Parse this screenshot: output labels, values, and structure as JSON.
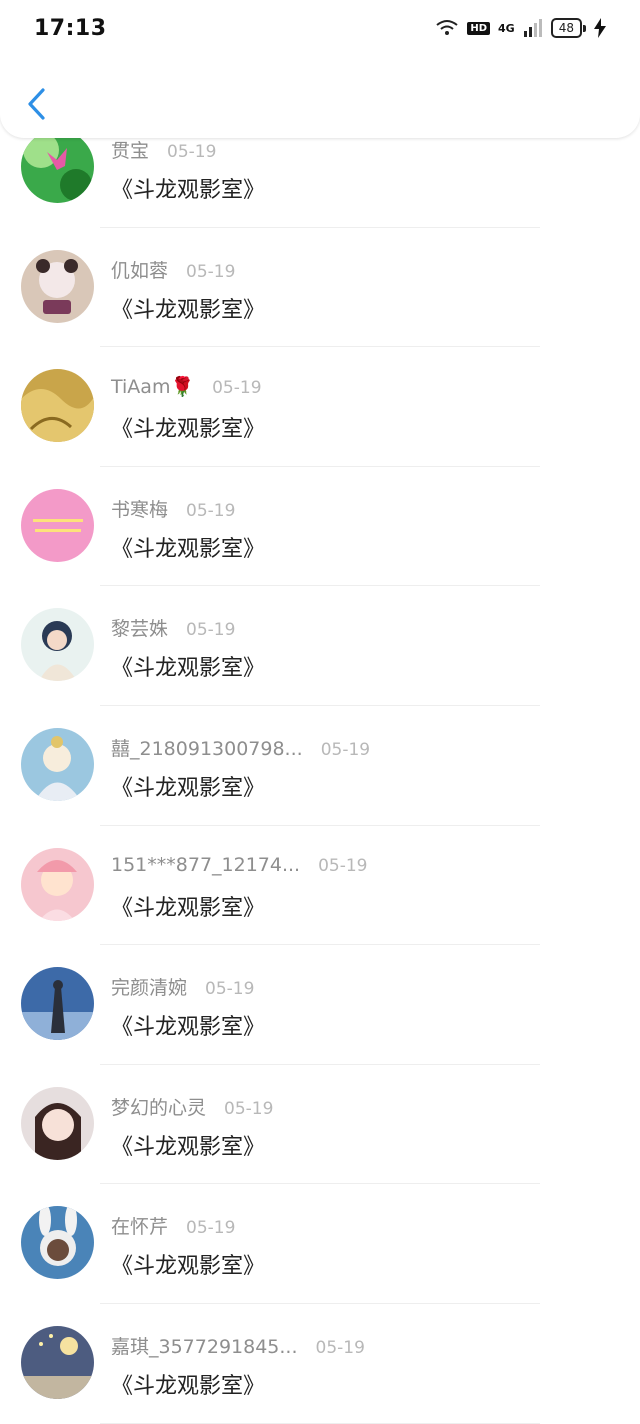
{
  "status_bar": {
    "time": "17:13",
    "hd": "HD",
    "network": "4G",
    "battery": "48"
  },
  "header": {
    "back_icon": "chevron-left-icon",
    "accent_color": "#2d8fe6"
  },
  "comments": [
    {
      "name": "贯宝",
      "date": "05-19",
      "text": "《斗龙观影室》"
    },
    {
      "name": "仉如蓉",
      "date": "05-19",
      "text": "《斗龙观影室》"
    },
    {
      "name": "TiAam🌹",
      "date": "05-19",
      "text": "《斗龙观影室》"
    },
    {
      "name": "书寒梅",
      "date": "05-19",
      "text": "《斗龙观影室》"
    },
    {
      "name": "黎芸姝",
      "date": "05-19",
      "text": "《斗龙观影室》"
    },
    {
      "name": "囍_218091300798...",
      "date": "05-19",
      "text": "《斗龙观影室》"
    },
    {
      "name": "151***877_12174...",
      "date": "05-19",
      "text": "《斗龙观影室》"
    },
    {
      "name": "完颜清婉",
      "date": "05-19",
      "text": "《斗龙观影室》"
    },
    {
      "name": "梦幻的心灵",
      "date": "05-19",
      "text": "《斗龙观影室》"
    },
    {
      "name": "在怀芹",
      "date": "05-19",
      "text": "《斗龙观影室》"
    },
    {
      "name": "嘉琪_3577291845...",
      "date": "05-19",
      "text": "《斗龙观影室》"
    }
  ]
}
